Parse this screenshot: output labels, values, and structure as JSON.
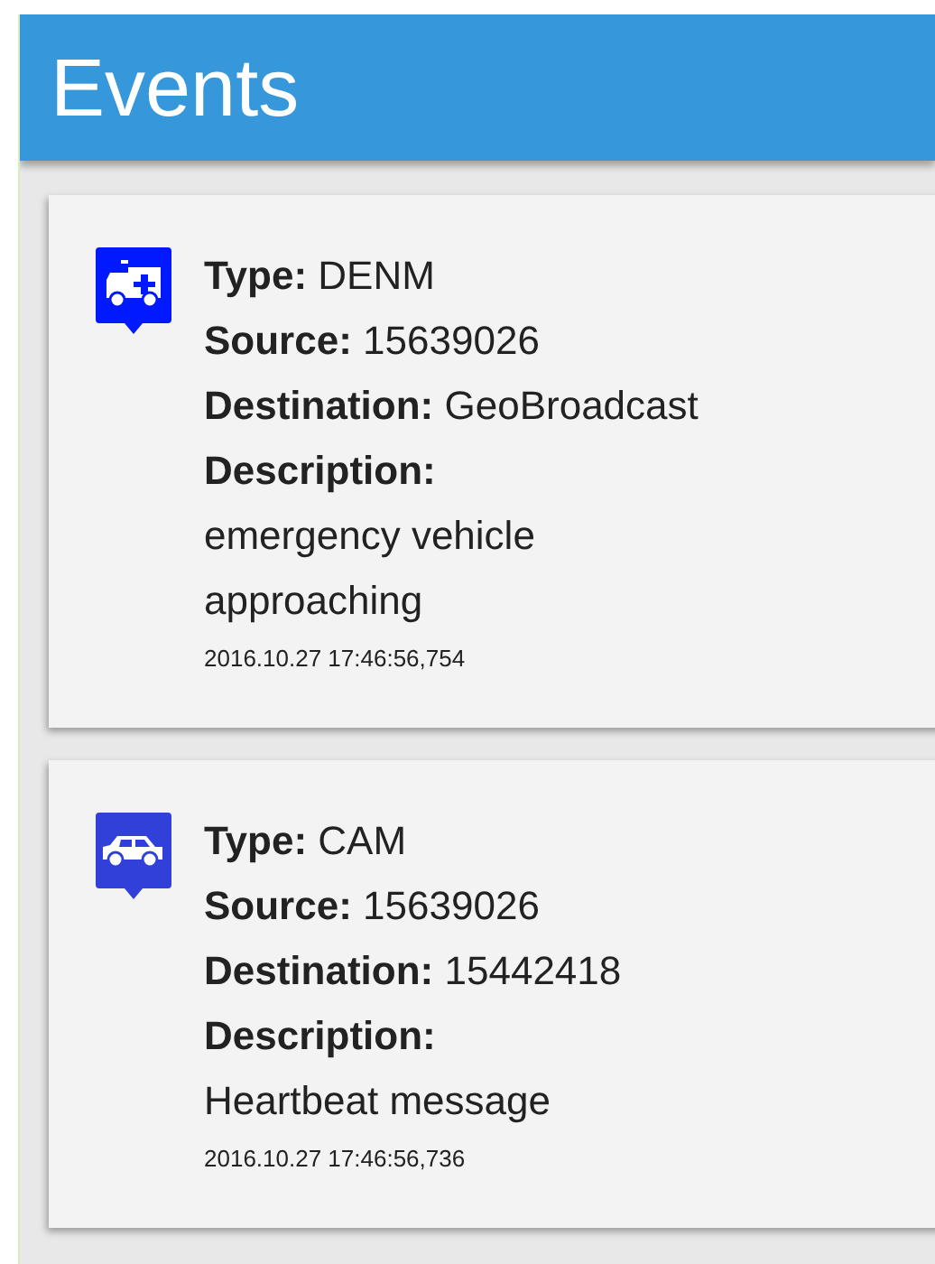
{
  "header": {
    "title": "Events"
  },
  "events": [
    {
      "kind": "ambulance",
      "fields": [
        {
          "kind": "inline",
          "label": "Type:",
          "value": "DENM"
        },
        {
          "kind": "inline",
          "label": "Source:",
          "value": "15639026"
        },
        {
          "kind": "inline",
          "label": "Destination:",
          "value": "GeoBroadcast"
        },
        {
          "kind": "block",
          "label": "Description:",
          "value": "emergency vehicle approaching"
        }
      ],
      "timestamp": "2016.10.27 17:46:56,754"
    },
    {
      "kind": "car",
      "fields": [
        {
          "kind": "inline",
          "label": "Type:",
          "value": "CAM"
        },
        {
          "kind": "inline",
          "label": "Source:",
          "value": "15639026"
        },
        {
          "kind": "inline",
          "label": "Destination:",
          "value": "15442418"
        },
        {
          "kind": "block",
          "label": "Description:",
          "value": "Heartbeat message"
        }
      ],
      "timestamp": "2016.10.27 17:46:56,736"
    }
  ]
}
